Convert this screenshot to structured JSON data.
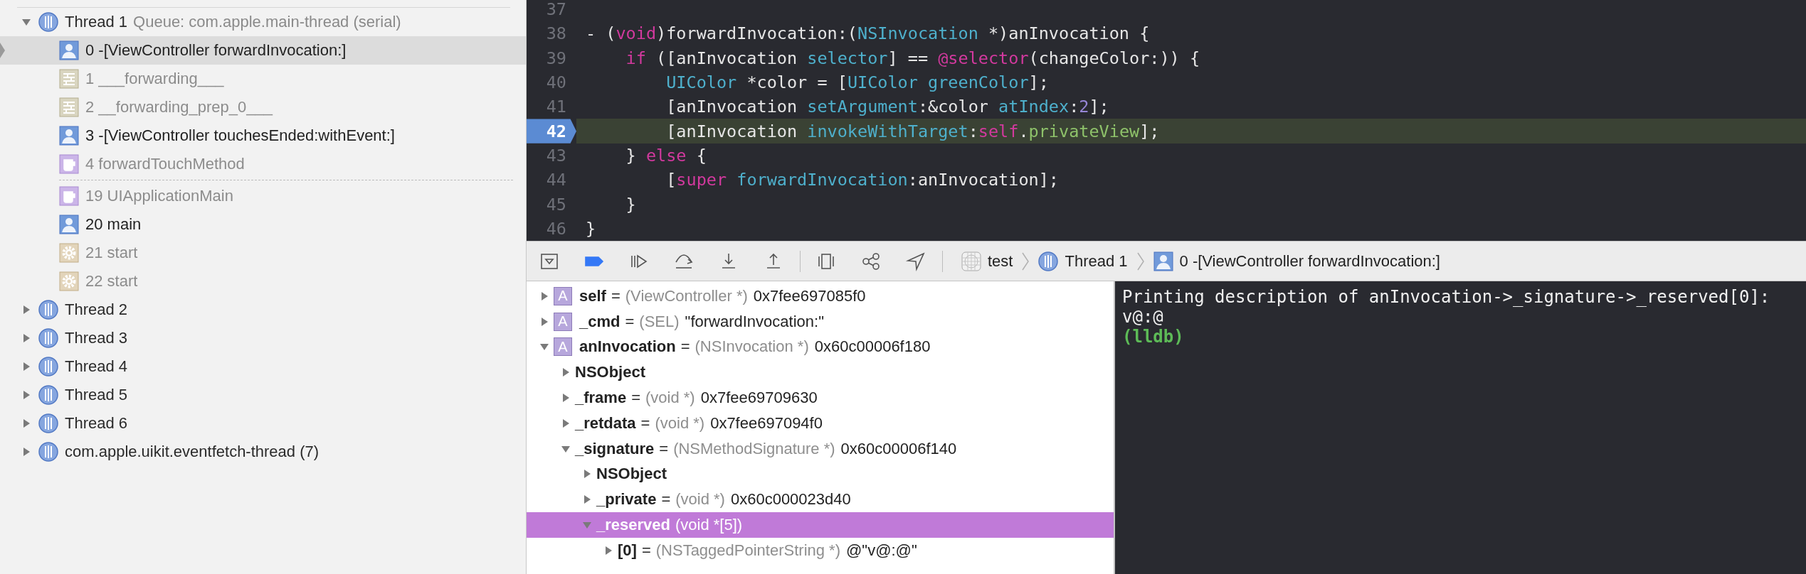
{
  "thread_navigator": {
    "threads": [
      {
        "name": "Thread 1",
        "queue": "Queue: com.apple.main-thread (serial)",
        "expanded": true,
        "frames": [
          {
            "label": "0 -[ViewController forwardInvocation:]",
            "kind": "user",
            "selected": true
          },
          {
            "label": "1 ___forwarding___",
            "kind": "system",
            "selected": false
          },
          {
            "label": "2 __forwarding_prep_0___",
            "kind": "system",
            "selected": false
          },
          {
            "label": "3 -[ViewController touchesEnded:withEvent:]",
            "kind": "user",
            "selected": false
          },
          {
            "label": "4 forwardTouchMethod",
            "kind": "framework",
            "selected": false,
            "gap_after": true
          },
          {
            "label": "19 UIApplicationMain",
            "kind": "framework",
            "selected": false
          },
          {
            "label": "20 main",
            "kind": "user",
            "selected": false
          },
          {
            "label": "21 start",
            "kind": "startup",
            "selected": false
          },
          {
            "label": "22 start",
            "kind": "startup",
            "selected": false
          }
        ]
      },
      {
        "name": "Thread 2",
        "expanded": false
      },
      {
        "name": "Thread 3",
        "expanded": false
      },
      {
        "name": "Thread 4",
        "expanded": false
      },
      {
        "name": "Thread 5",
        "expanded": false
      },
      {
        "name": "Thread 6",
        "expanded": false
      },
      {
        "name": "com.apple.uikit.eventfetch-thread (7)",
        "expanded": false
      }
    ]
  },
  "editor": {
    "lines": [
      {
        "number": "37",
        "current": false
      },
      {
        "number": "38",
        "current": false,
        "tokens": [
          {
            "text": "- (",
            "kind": "plain"
          },
          {
            "text": "void",
            "kind": "keyword"
          },
          {
            "text": ")forwardInvocation:(",
            "kind": "plain"
          },
          {
            "text": "NSInvocation",
            "kind": "type"
          },
          {
            "text": " *)anInvocation {",
            "kind": "plain"
          }
        ]
      },
      {
        "number": "39",
        "current": false,
        "tokens": [
          {
            "text": "    if",
            "kind": "keyword"
          },
          {
            "text": " ([anInvocation ",
            "kind": "plain"
          },
          {
            "text": "selector",
            "kind": "method"
          },
          {
            "text": "] == ",
            "kind": "plain"
          },
          {
            "text": "@selector",
            "kind": "keyword"
          },
          {
            "text": "(changeColor:)) {",
            "kind": "plain"
          }
        ]
      },
      {
        "number": "40",
        "current": false,
        "tokens": [
          {
            "text": "        UIColor",
            "kind": "type"
          },
          {
            "text": " *color = [",
            "kind": "plain"
          },
          {
            "text": "UIColor greenColor",
            "kind": "method"
          },
          {
            "text": "];",
            "kind": "plain"
          }
        ]
      },
      {
        "number": "41",
        "current": false,
        "tokens": [
          {
            "text": "        [anInvocation ",
            "kind": "plain"
          },
          {
            "text": "setArgument",
            "kind": "method"
          },
          {
            "text": ":&color ",
            "kind": "plain"
          },
          {
            "text": "atIndex",
            "kind": "method"
          },
          {
            "text": ":",
            "kind": "plain"
          },
          {
            "text": "2",
            "kind": "number"
          },
          {
            "text": "];",
            "kind": "plain"
          }
        ]
      },
      {
        "number": "42",
        "current": true,
        "tokens": [
          {
            "text": "        [anInvocation ",
            "kind": "plain"
          },
          {
            "text": "invokeWithTarget",
            "kind": "method"
          },
          {
            "text": ":",
            "kind": "plain"
          },
          {
            "text": "self",
            "kind": "keyword"
          },
          {
            "text": ".",
            "kind": "plain"
          },
          {
            "text": "privateView",
            "kind": "property"
          },
          {
            "text": "];",
            "kind": "plain"
          }
        ]
      },
      {
        "number": "43",
        "current": false,
        "tokens": [
          {
            "text": "    } ",
            "kind": "plain"
          },
          {
            "text": "else",
            "kind": "keyword"
          },
          {
            "text": " {",
            "kind": "plain"
          }
        ]
      },
      {
        "number": "44",
        "current": false,
        "tokens": [
          {
            "text": "        [",
            "kind": "plain"
          },
          {
            "text": "super ",
            "kind": "keyword"
          },
          {
            "text": "forwardInvocation",
            "kind": "method"
          },
          {
            "text": ":anInvocation];",
            "kind": "plain"
          }
        ]
      },
      {
        "number": "45",
        "current": false,
        "tokens": [
          {
            "text": "    }",
            "kind": "plain"
          }
        ]
      },
      {
        "number": "46",
        "current": false,
        "tokens": [
          {
            "text": "}",
            "kind": "plain"
          }
        ]
      }
    ]
  },
  "debug_bar": {
    "breakpoints_active": true,
    "breadcrumbs": [
      {
        "label": "test",
        "kind": "app"
      },
      {
        "label": "Thread 1",
        "kind": "thread"
      },
      {
        "label": "0 -[ViewController forwardInvocation:]",
        "kind": "frame"
      }
    ]
  },
  "variables": [
    {
      "name": "self",
      "eq": "=",
      "type": "(ViewController *)",
      "value": "0x7fee697085f0",
      "kind": "local",
      "icon_letter": "A",
      "expanded": false,
      "selected": false
    },
    {
      "name": "_cmd",
      "eq": "=",
      "type": "(SEL)",
      "value": "\"forwardInvocation:\"",
      "kind": "local",
      "icon_letter": "A",
      "expanded": false,
      "selected": false
    },
    {
      "name": "anInvocation",
      "eq": "=",
      "type": "(NSInvocation *)",
      "value": "0x60c00006f180",
      "kind": "local",
      "icon_letter": "A",
      "expanded": true,
      "selected": false,
      "children": [
        {
          "name": "NSObject",
          "expanded": false,
          "selected": false
        },
        {
          "name": "_frame",
          "eq": "=",
          "type": "(void *)",
          "value": "0x7fee69709630",
          "expanded": false,
          "selected": false
        },
        {
          "name": "_retdata",
          "eq": "=",
          "type": "(void *)",
          "value": "0x7fee697094f0",
          "expanded": false,
          "selected": false
        },
        {
          "name": "_signature",
          "eq": "=",
          "type": "(NSMethodSignature *)",
          "value": "0x60c00006f140",
          "expanded": true,
          "selected": false,
          "children": [
            {
              "name": "NSObject",
              "expanded": false,
              "selected": false
            },
            {
              "name": "_private",
              "eq": "=",
              "type": "(void *)",
              "value": "0x60c000023d40",
              "expanded": false,
              "selected": false
            },
            {
              "name": "_reserved",
              "type": "(void *[5])",
              "expanded": true,
              "selected": true,
              "children": [
                {
                  "name": "[0]",
                  "eq": "=",
                  "type": "(NSTaggedPointerString *)",
                  "value": "@\"v@:@\"",
                  "expanded": false,
                  "selected": false
                }
              ]
            }
          ]
        }
      ]
    }
  ],
  "console": {
    "lines": [
      {
        "text": "Printing description of anInvocation->_signature->_reserved[0]:",
        "kind": "output"
      },
      {
        "text": "v@:@",
        "kind": "output"
      },
      {
        "text": "(lldb)",
        "kind": "prompt"
      }
    ]
  }
}
